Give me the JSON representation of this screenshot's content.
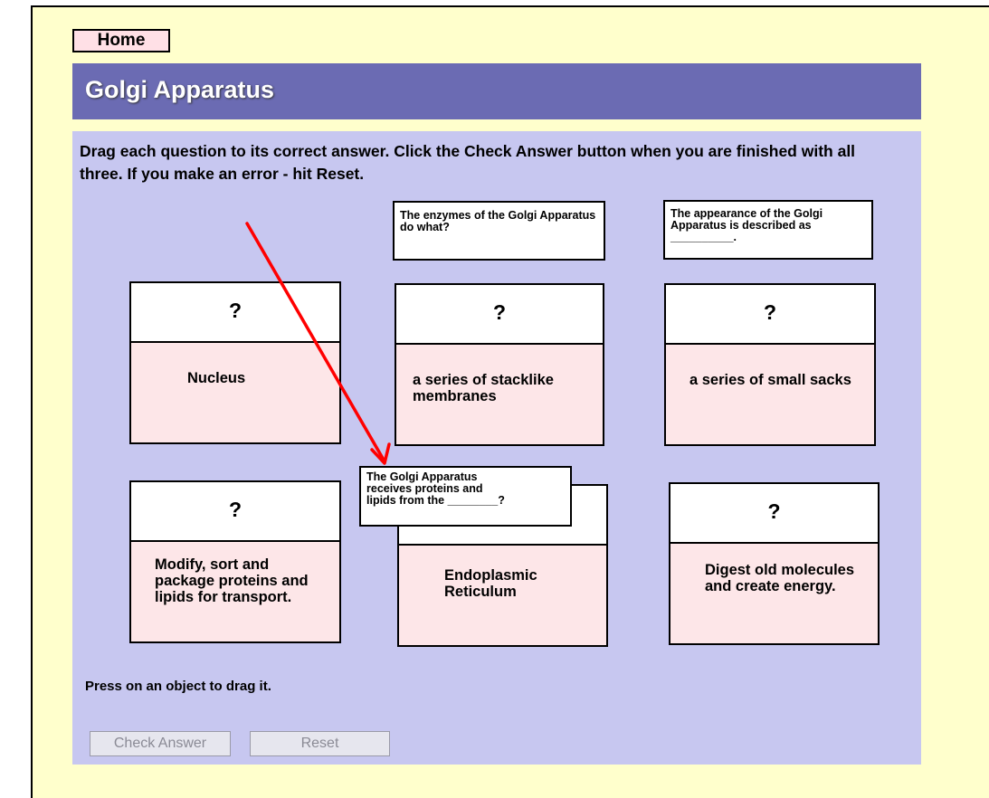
{
  "nav": {
    "home_label": "Home"
  },
  "header": {
    "title": "Golgi Apparatus"
  },
  "instructions": "Drag each question to its correct answer.  Click the Check Answer button when you are finished with all three.  If you make an error - hit Reset.",
  "questions": [
    "The enzymes of the Golgi Apparatus do what?",
    "The appearance of the Golgi Apparatus is described as __________.",
    "The Golgi Apparatus receives proteins and lipids from the ________?"
  ],
  "cards": [
    {
      "slot": "?",
      "answer": "Nucleus"
    },
    {
      "slot": "?",
      "answer": "a series of stacklike membranes"
    },
    {
      "slot": "?",
      "answer": "a series of small sacks"
    },
    {
      "slot": "?",
      "answer": "Modify, sort and package proteins and lipids for transport."
    },
    {
      "slot": "?",
      "answer": "Endoplasmic Reticulum"
    },
    {
      "slot": "?",
      "answer": "Digest old molecules and create energy."
    }
  ],
  "footer": {
    "hint": "Press on an object to drag it.",
    "check_label": "Check Answer",
    "reset_label": "Reset"
  },
  "colors": {
    "page_bg": "#ffffcc",
    "title_bar": "#6b6bb3",
    "panel": "#c7c7f0",
    "answer_bg": "#fde6e8",
    "arrow": "#ff0000"
  }
}
